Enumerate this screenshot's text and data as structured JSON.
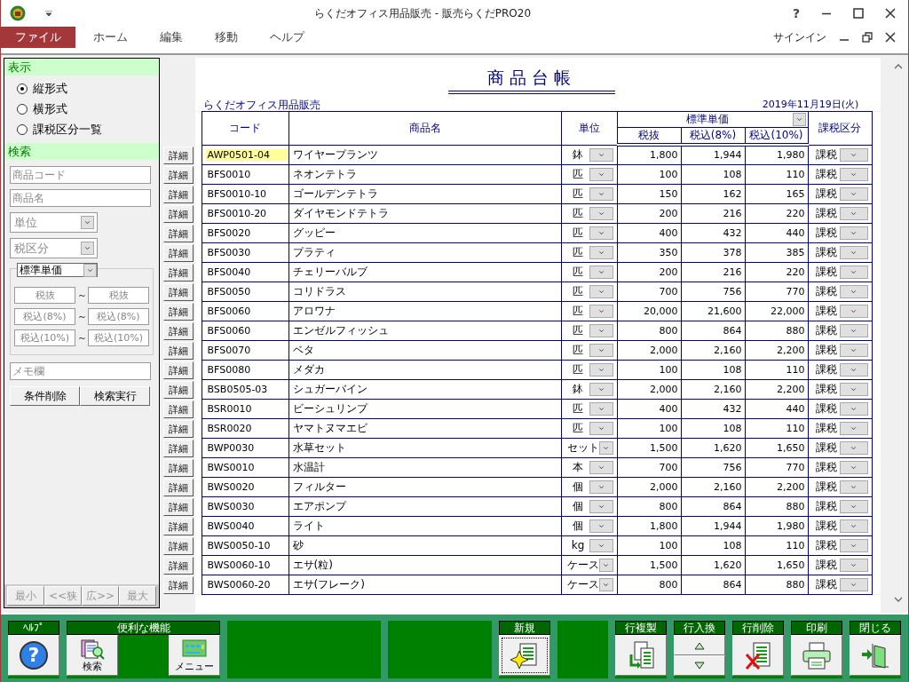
{
  "window": {
    "title": "らくだオフィス用品販売 - 販売らくだPRO20",
    "help": "?"
  },
  "menu": {
    "items": [
      {
        "label": "ファイル",
        "selected": true
      },
      {
        "label": "ホーム",
        "selected": false
      },
      {
        "label": "編集",
        "selected": false
      },
      {
        "label": "移動",
        "selected": false
      },
      {
        "label": "ヘルプ",
        "selected": false
      }
    ],
    "sign_in": "サインイン"
  },
  "display_panel": {
    "heading": "表示",
    "options": [
      {
        "label": "縦形式",
        "selected": true
      },
      {
        "label": "横形式",
        "selected": false
      },
      {
        "label": "課税区分一覧",
        "selected": false
      }
    ]
  },
  "search_panel": {
    "heading": "検索",
    "fields": [
      {
        "kind": "text",
        "placeholder": "商品コード"
      },
      {
        "kind": "text",
        "placeholder": "商品名"
      },
      {
        "kind": "select",
        "placeholder": "単位"
      },
      {
        "kind": "select",
        "placeholder": "税区分"
      }
    ],
    "price_select": "標準単価",
    "ranges": [
      {
        "from_placeholder": "税抜",
        "separator": "～",
        "to_placeholder": "税抜"
      },
      {
        "from_placeholder": "税込(8%)",
        "separator": "～",
        "to_placeholder": "税込(8%)"
      },
      {
        "from_placeholder": "税込(10%)",
        "separator": "～",
        "to_placeholder": "税込(10%)"
      }
    ],
    "memo_placeholder": "メモ欄",
    "buttons": [
      "条件削除",
      "検索実行"
    ]
  },
  "zoom_buttons": [
    {
      "label": "最小",
      "disabled": true
    },
    {
      "label": "<<狭",
      "disabled": true
    },
    {
      "label": "広>>",
      "disabled": true
    },
    {
      "label": "最大",
      "disabled": true
    }
  ],
  "report": {
    "title": "商品台帳",
    "company": "らくだオフィス用品販売",
    "date": "2019年11月19日(火)",
    "columns": {
      "code": "コード",
      "name": "商品名",
      "unit": "単位",
      "price_group": "標準単価",
      "tax_excluded": "税抜",
      "tax_8": "税込(8%)",
      "tax_10": "税込(10%)",
      "tax_category": "課税区分"
    },
    "rows": [
      {
        "detail": "詳細",
        "code": "AWP0501-04",
        "name": "ワイヤープランツ",
        "unit": "鉢",
        "excl": "1,800",
        "incl8": "1,944",
        "incl10": "1,980",
        "tax": "課税",
        "selected": true
      },
      {
        "detail": "詳細",
        "code": "BFS0010",
        "name": "ネオンテトラ",
        "unit": "匹",
        "excl": "100",
        "incl8": "108",
        "incl10": "110",
        "tax": "課税",
        "selected": false
      },
      {
        "detail": "詳細",
        "code": "BFS0010-10",
        "name": "ゴールデンテトラ",
        "unit": "匹",
        "excl": "150",
        "incl8": "162",
        "incl10": "165",
        "tax": "課税",
        "selected": false
      },
      {
        "detail": "詳細",
        "code": "BFS0010-20",
        "name": "ダイヤモンドテトラ",
        "unit": "匹",
        "excl": "200",
        "incl8": "216",
        "incl10": "220",
        "tax": "課税",
        "selected": false
      },
      {
        "detail": "詳細",
        "code": "BFS0020",
        "name": "グッピー",
        "unit": "匹",
        "excl": "400",
        "incl8": "432",
        "incl10": "440",
        "tax": "課税",
        "selected": false
      },
      {
        "detail": "詳細",
        "code": "BFS0030",
        "name": "プラティ",
        "unit": "匹",
        "excl": "350",
        "incl8": "378",
        "incl10": "385",
        "tax": "課税",
        "selected": false
      },
      {
        "detail": "詳細",
        "code": "BFS0040",
        "name": "チェリーバルブ",
        "unit": "匹",
        "excl": "200",
        "incl8": "216",
        "incl10": "220",
        "tax": "課税",
        "selected": false
      },
      {
        "detail": "詳細",
        "code": "BFS0050",
        "name": "コリドラス",
        "unit": "匹",
        "excl": "700",
        "incl8": "756",
        "incl10": "770",
        "tax": "課税",
        "selected": false
      },
      {
        "detail": "詳細",
        "code": "BFS0060",
        "name": "アロワナ",
        "unit": "匹",
        "excl": "20,000",
        "incl8": "21,600",
        "incl10": "22,000",
        "tax": "課税",
        "selected": false
      },
      {
        "detail": "詳細",
        "code": "BFS0060",
        "name": "エンゼルフィッシュ",
        "unit": "匹",
        "excl": "800",
        "incl8": "864",
        "incl10": "880",
        "tax": "課税",
        "selected": false
      },
      {
        "detail": "詳細",
        "code": "BFS0070",
        "name": "ベタ",
        "unit": "匹",
        "excl": "2,000",
        "incl8": "2,160",
        "incl10": "2,200",
        "tax": "課税",
        "selected": false
      },
      {
        "detail": "詳細",
        "code": "BFS0080",
        "name": "メダカ",
        "unit": "匹",
        "excl": "100",
        "incl8": "108",
        "incl10": "110",
        "tax": "課税",
        "selected": false
      },
      {
        "detail": "詳細",
        "code": "BSB0505-03",
        "name": "シュガーバイン",
        "unit": "鉢",
        "excl": "2,000",
        "incl8": "2,160",
        "incl10": "2,200",
        "tax": "課税",
        "selected": false
      },
      {
        "detail": "詳細",
        "code": "BSR0010",
        "name": "ビーシュリンプ",
        "unit": "匹",
        "excl": "400",
        "incl8": "432",
        "incl10": "440",
        "tax": "課税",
        "selected": false
      },
      {
        "detail": "詳細",
        "code": "BSR0020",
        "name": "ヤマトヌマエビ",
        "unit": "匹",
        "excl": "100",
        "incl8": "108",
        "incl10": "110",
        "tax": "課税",
        "selected": false
      },
      {
        "detail": "詳細",
        "code": "BWP0030",
        "name": "水草セット",
        "unit": "セット",
        "excl": "1,500",
        "incl8": "1,620",
        "incl10": "1,650",
        "tax": "課税",
        "selected": false
      },
      {
        "detail": "詳細",
        "code": "BWS0010",
        "name": "水温計",
        "unit": "本",
        "excl": "700",
        "incl8": "756",
        "incl10": "770",
        "tax": "課税",
        "selected": false
      },
      {
        "detail": "詳細",
        "code": "BWS0020",
        "name": "フィルター",
        "unit": "個",
        "excl": "2,000",
        "incl8": "2,160",
        "incl10": "2,200",
        "tax": "課税",
        "selected": false
      },
      {
        "detail": "詳細",
        "code": "BWS0030",
        "name": "エアポンプ",
        "unit": "個",
        "excl": "800",
        "incl8": "864",
        "incl10": "880",
        "tax": "課税",
        "selected": false
      },
      {
        "detail": "詳細",
        "code": "BWS0040",
        "name": "ライト",
        "unit": "個",
        "excl": "1,800",
        "incl8": "1,944",
        "incl10": "1,980",
        "tax": "課税",
        "selected": false
      },
      {
        "detail": "詳細",
        "code": "BWS0050-10",
        "name": "砂",
        "unit": "kg",
        "excl": "100",
        "incl8": "108",
        "incl10": "110",
        "tax": "課税",
        "selected": false
      },
      {
        "detail": "詳細",
        "code": "BWS0060-10",
        "name": "エサ(粒)",
        "unit": "ケース",
        "excl": "1,500",
        "incl8": "1,620",
        "incl10": "1,650",
        "tax": "課税",
        "selected": false
      },
      {
        "detail": "詳細",
        "code": "BWS0060-20",
        "name": "エサ(フレーク)",
        "unit": "ケース",
        "excl": "800",
        "incl8": "864",
        "incl10": "880",
        "tax": "課税",
        "selected": false
      }
    ]
  },
  "toolbar": [
    {
      "kind": "group",
      "label": "ﾍﾙﾌﾟ",
      "buttons": [
        {
          "kind": "help",
          "symbol": "?",
          "focused": false
        }
      ]
    },
    {
      "kind": "group",
      "label": "便利な機能",
      "buttons": [
        {
          "kind": "search",
          "text": "検索",
          "focused": false
        },
        {
          "kind": "menu",
          "text": "メニュー",
          "focused": false
        }
      ]
    },
    {
      "kind": "blank"
    },
    {
      "kind": "blank"
    },
    {
      "kind": "group",
      "label": "新規",
      "buttons": [
        {
          "kind": "new",
          "focused": true
        }
      ]
    },
    {
      "kind": "blank"
    },
    {
      "kind": "group",
      "label": "行複製",
      "buttons": [
        {
          "kind": "copy",
          "focused": false
        }
      ]
    },
    {
      "kind": "group",
      "label": "行入換",
      "buttons": [
        {
          "kind": "swap",
          "focused": false
        }
      ]
    },
    {
      "kind": "group",
      "label": "行削除",
      "buttons": [
        {
          "kind": "delete",
          "focused": false
        }
      ]
    },
    {
      "kind": "group",
      "label": "印刷",
      "buttons": [
        {
          "kind": "print",
          "focused": false
        }
      ]
    },
    {
      "kind": "group",
      "label": "閉じる",
      "buttons": [
        {
          "kind": "exit",
          "focused": false
        }
      ]
    }
  ]
}
